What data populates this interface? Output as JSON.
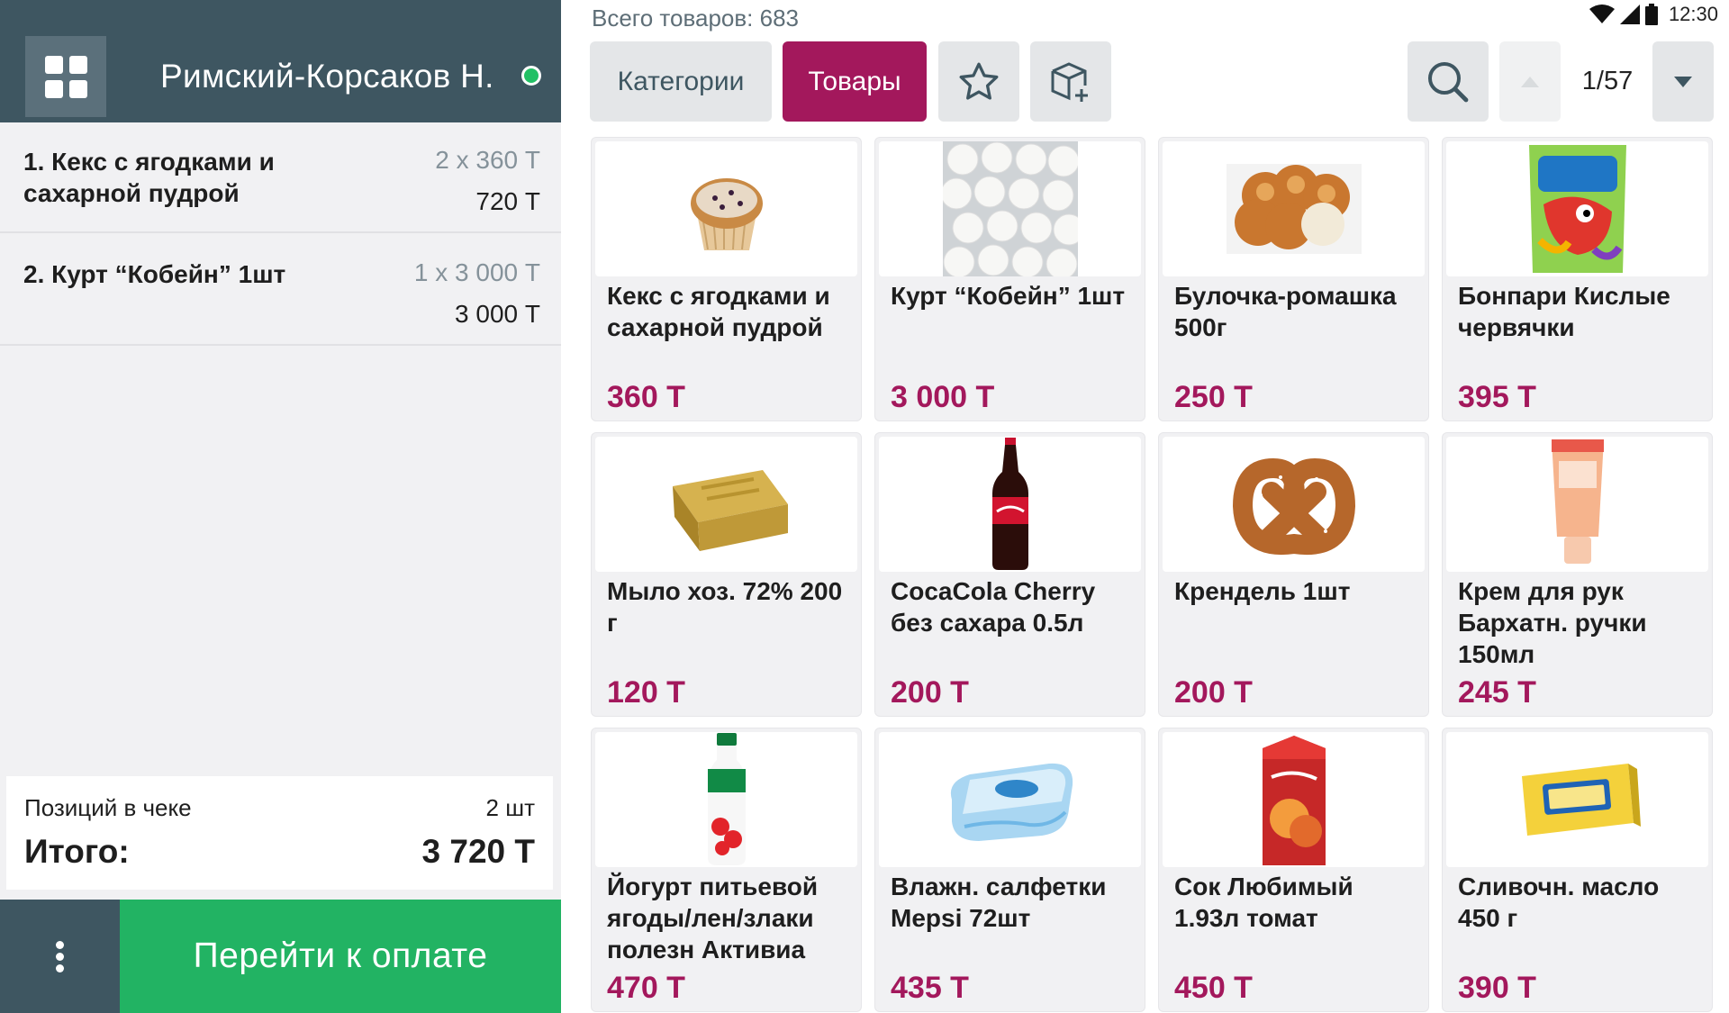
{
  "header": {
    "cashier_name": "Римский-Корсаков Н.",
    "status_color": "#22c065",
    "menu_icon": "grid-icon"
  },
  "receipt": {
    "items": [
      {
        "name": "1. Кекс с ягодками и сахарной пудрой",
        "qty": "2 x 360 Т",
        "sum": "720 Т"
      },
      {
        "name": "2. Курт “Кобейн” 1шт",
        "qty": "1 x 3 000 Т",
        "sum": "3 000 Т"
      }
    ],
    "positions_label": "Позиций в чеке",
    "positions_value": "2 шт",
    "total_label": "Итого:",
    "total_value": "3 720 Т"
  },
  "footer": {
    "more_icon": "more-vertical-icon",
    "pay_label": "Перейти к оплате"
  },
  "catalog": {
    "total_count": "Всего товаров: 683",
    "tabs": {
      "categories": "Категории",
      "products": "Товары"
    },
    "page": "1/57",
    "status_time": "12:30",
    "accent_color": "#a3185c",
    "products": [
      {
        "name": "Кекс с ягодками и сахарной пудрой",
        "price": "360 Т",
        "image": "muffin-image"
      },
      {
        "name": "Курт “Кобейн” 1шт",
        "price": "3 000 Т",
        "image": "kurt-image"
      },
      {
        "name": "Булочка-ромашка 500г",
        "price": "250 Т",
        "image": "bun-image"
      },
      {
        "name": "Бонпари Кислые червячки",
        "price": "395 Т",
        "image": "candy-bag-image"
      },
      {
        "name": "Мыло хоз. 72% 200 г",
        "price": "120 Т",
        "image": "soap-image"
      },
      {
        "name": "CocaCola Cherry без сахара 0.5л",
        "price": "200 Т",
        "image": "cola-bottle-image"
      },
      {
        "name": "Крендель 1шт",
        "price": "200 Т",
        "image": "pretzel-image"
      },
      {
        "name": "Крем для рук Бархатн. ручки 150мл",
        "price": "245 Т",
        "image": "hand-cream-image"
      },
      {
        "name": "Йогурт питьевой ягоды/лен/злаки полезн Активиа",
        "price": "470 Т",
        "image": "yogurt-bottle-image"
      },
      {
        "name": "Влажн. салфетки Mepsi 72шт",
        "price": "435 Т",
        "image": "wet-wipes-image"
      },
      {
        "name": "Сок Любимый 1.93л томат",
        "price": "450 Т",
        "image": "juice-box-image"
      },
      {
        "name": "Сливочн. масло 450 г",
        "price": "390 Т",
        "image": "butter-image"
      }
    ]
  }
}
